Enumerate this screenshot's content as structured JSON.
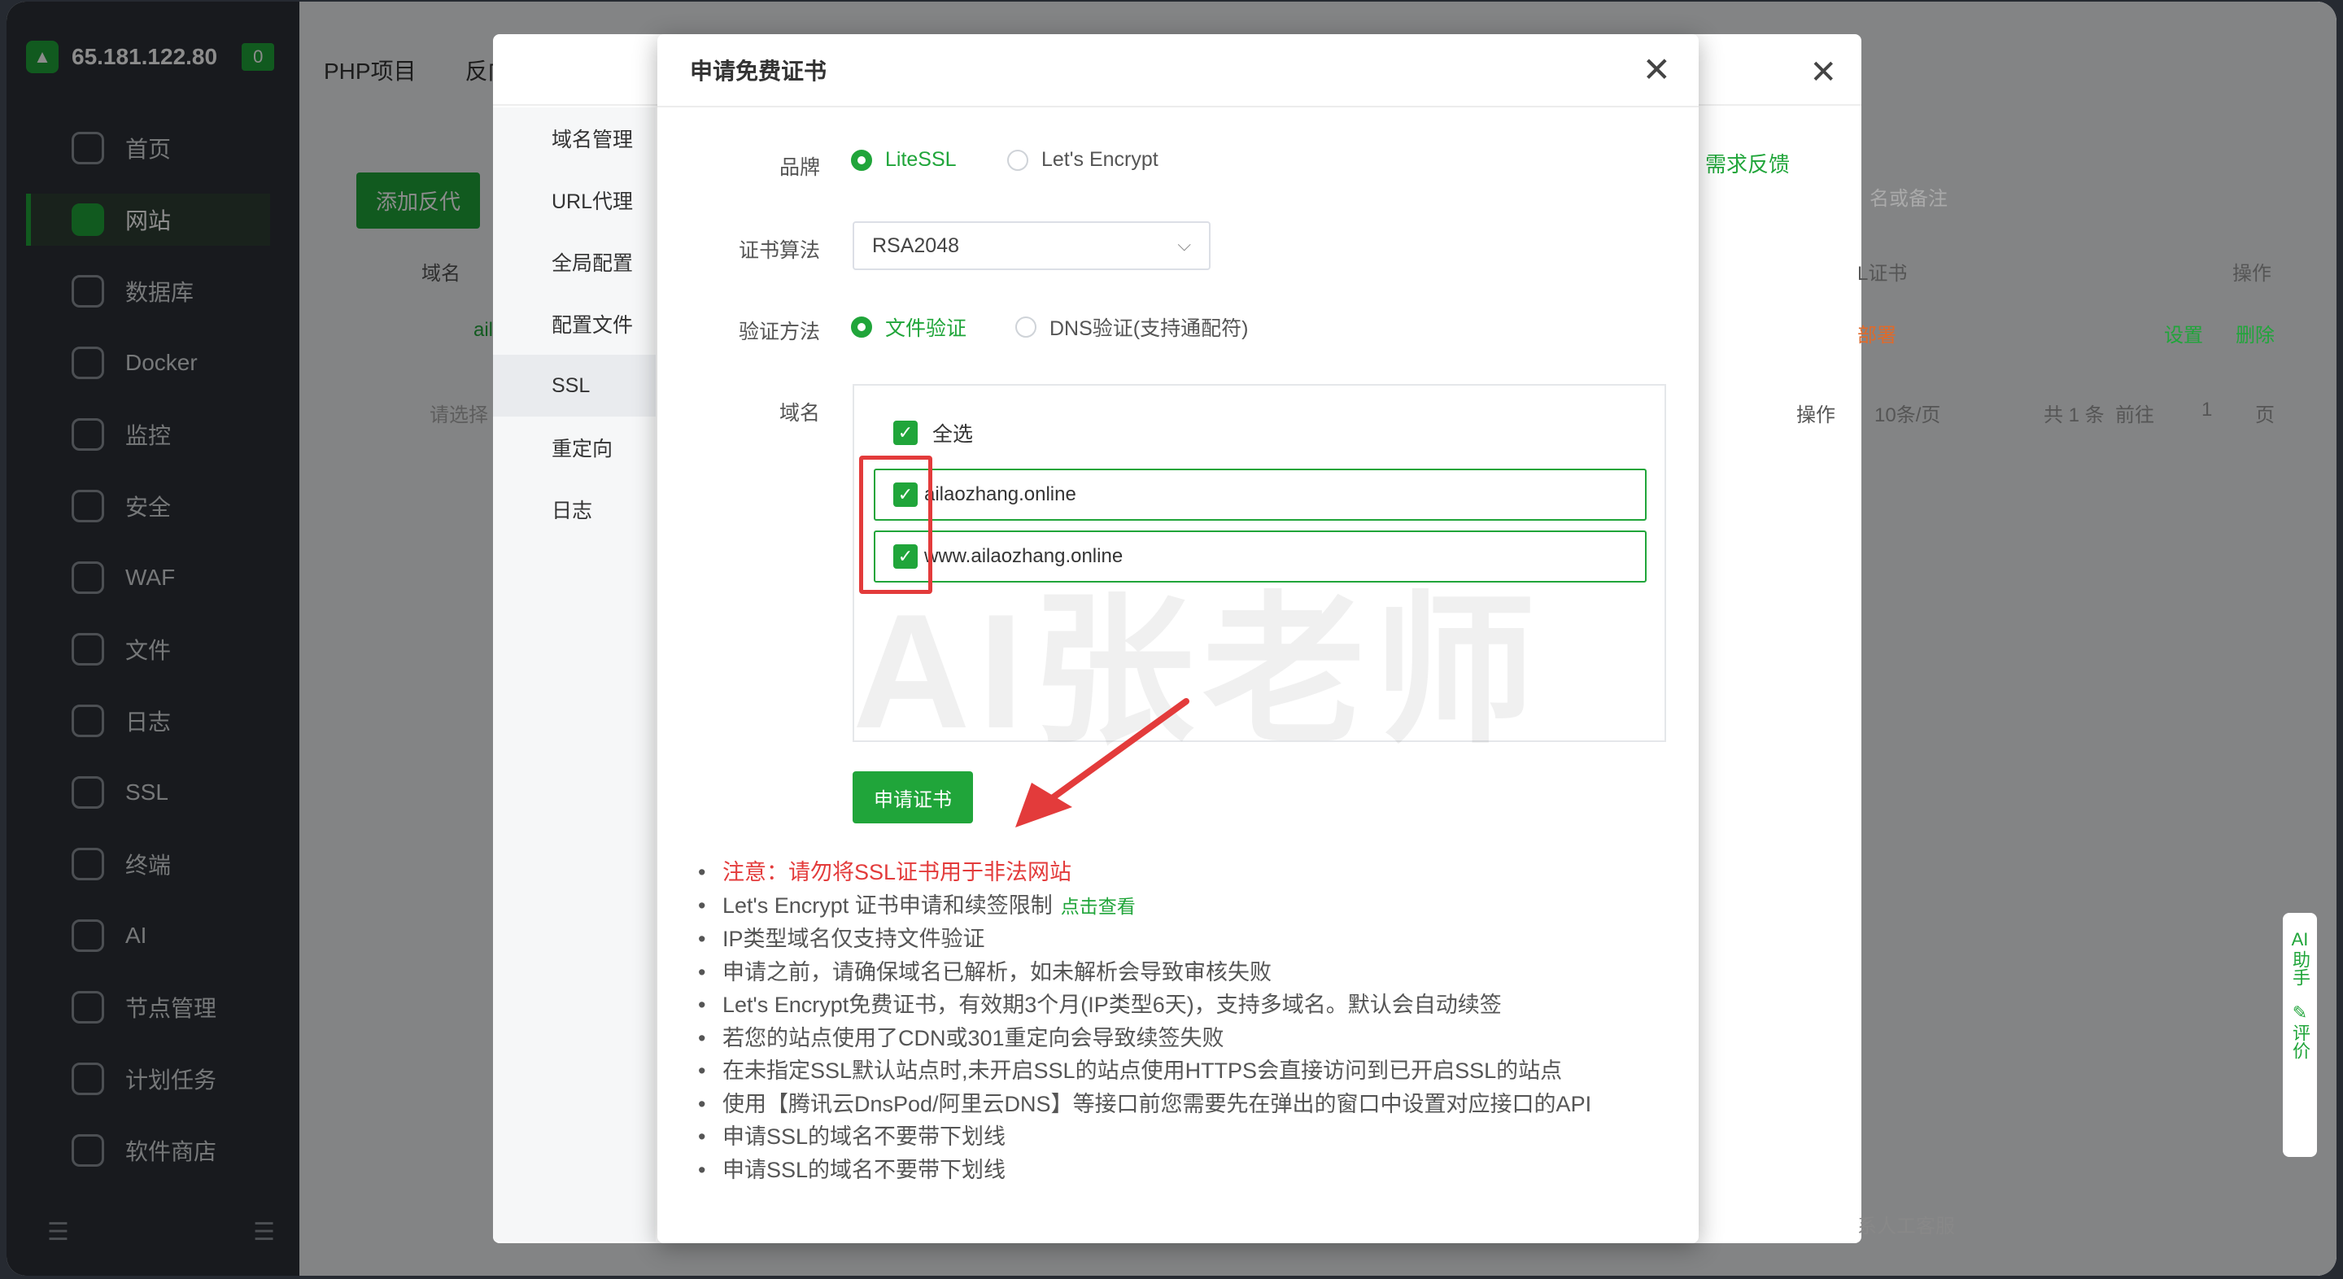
{
  "sidebar": {
    "ip": "65.181.122.80",
    "badge": "0",
    "items": [
      {
        "label": "首页",
        "icon": "home-icon"
      },
      {
        "label": "网站",
        "icon": "website-icon"
      },
      {
        "label": "数据库",
        "icon": "database-icon"
      },
      {
        "label": "Docker",
        "icon": "docker-icon"
      },
      {
        "label": "监控",
        "icon": "monitor-icon"
      },
      {
        "label": "安全",
        "icon": "shield-icon"
      },
      {
        "label": "WAF",
        "icon": "waf-icon"
      },
      {
        "label": "文件",
        "icon": "folder-icon"
      },
      {
        "label": "日志",
        "icon": "log-icon"
      },
      {
        "label": "SSL",
        "icon": "ssl-icon"
      },
      {
        "label": "终端",
        "icon": "terminal-icon"
      },
      {
        "label": "AI",
        "icon": "ai-icon"
      },
      {
        "label": "节点管理",
        "icon": "node-icon"
      },
      {
        "label": "计划任务",
        "icon": "calendar-icon"
      },
      {
        "label": "软件商店",
        "icon": "store-icon"
      }
    ],
    "foot_left": "☰",
    "foot_right": "☰"
  },
  "main": {
    "tabs": [
      "PHP项目",
      "反向代理项目"
    ],
    "add_button": "添加反代",
    "col_domain": "域名",
    "row_domain": "ail",
    "batch_placeholder": "请选择"
  },
  "bg_modal": {
    "side_items": [
      "域名管理",
      "URL代理",
      "全局配置",
      "配置文件",
      "SSL",
      "重定向",
      "日志"
    ],
    "feedback": "需求反馈",
    "search_placeholder": "名或备注",
    "col_ssl": "L证书",
    "col_action": "操作",
    "row_status": "部署",
    "row_set": "设置",
    "row_delete": "删除",
    "pager_action": "操作",
    "pager_size": "10条/页",
    "pager_total": "共 1 条",
    "pager_goto": "前往",
    "pager_page": "1",
    "pager_unit": "页",
    "service": "系人工客服"
  },
  "modal": {
    "title": "申请免费证书",
    "brand_label": "品牌",
    "brand_options": [
      "LiteSSL",
      "Let's Encrypt"
    ],
    "algo_label": "证书算法",
    "algo_value": "RSA2048",
    "verify_label": "验证方法",
    "verify_options": [
      "文件验证",
      "DNS验证(支持通配符)"
    ],
    "domain_label": "域名",
    "select_all": "全选",
    "domains": [
      "ailaozhang.online",
      "www.ailaozhang.online"
    ],
    "watermark": "AI张老师",
    "apply_button": "申请证书",
    "notes": {
      "warn": "注意：请勿将SSL证书用于非法网站",
      "le_limit": "Let's Encrypt 证书申请和续签限制",
      "le_link": "点击查看",
      "items": [
        "IP类型域名仅支持文件验证",
        "申请之前，请确保域名已解析，如未解析会导致审核失败",
        "Let's Encrypt免费证书，有效期3个月(IP类型6天)，支持多域名。默认会自动续签",
        "若您的站点使用了CDN或301重定向会导致续签失败",
        "在未指定SSL默认站点时,未开启SSL的站点使用HTTPS会直接访问到已开启SSL的站点",
        "使用【腾讯云DnsPod/阿里云DNS】等接口前您需要先在弹出的窗口中设置对应接口的API",
        "申请SSL的域名不要带下划线",
        "申请SSL的域名不要带下划线"
      ]
    }
  },
  "ai_helper": {
    "label_ai": "AI",
    "label_help": "助手",
    "label_eval": "评价"
  },
  "colors": {
    "brand": "#20a53a",
    "warn": "#e33b3b",
    "arrow": "#e33b3b"
  }
}
